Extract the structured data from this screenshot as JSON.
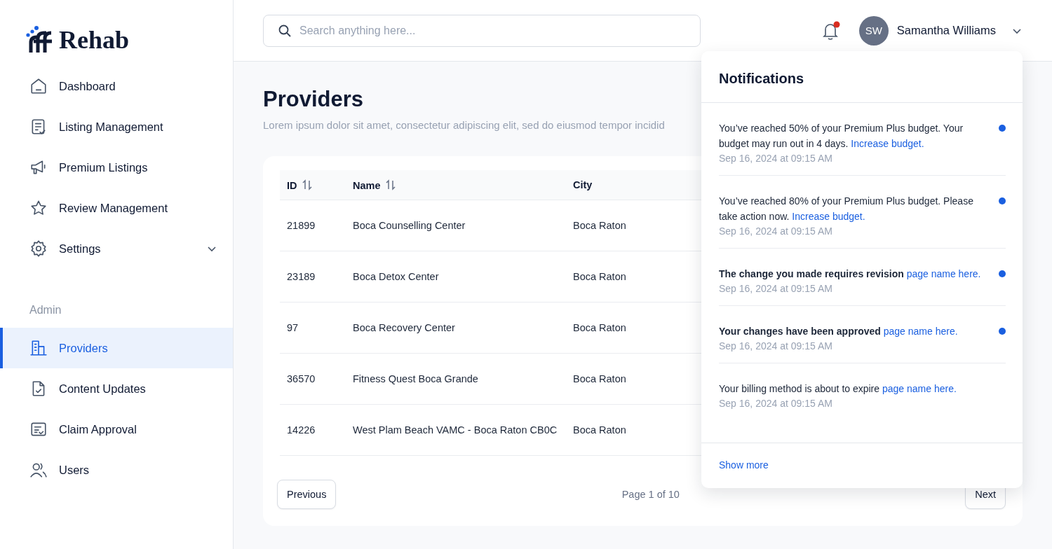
{
  "logo": {
    "text": "Rehab"
  },
  "sidebar": {
    "items": [
      {
        "label": "Dashboard",
        "selected": false
      },
      {
        "label": "Listing Management",
        "selected": false
      },
      {
        "label": "Premium Listings",
        "selected": false
      },
      {
        "label": "Review Management",
        "selected": false
      },
      {
        "label": "Settings",
        "selected": false,
        "expanded": false
      }
    ],
    "section_label": "Admin",
    "admin_items": [
      {
        "label": "Providers",
        "selected": true
      },
      {
        "label": "Content Updates",
        "selected": false
      },
      {
        "label": "Claim Approval",
        "selected": false
      },
      {
        "label": "Users",
        "selected": false
      }
    ]
  },
  "search": {
    "placeholder": "Search anything here..."
  },
  "user": {
    "initials": "SW",
    "name": "Samantha Williams",
    "has_unread": true
  },
  "page": {
    "title": "Providers",
    "subtitle": "Lorem ipsum dolor sit amet, consectetur adipiscing elit, sed do eiusmod tempor incidid"
  },
  "table": {
    "columns": [
      {
        "label": "ID",
        "sortable": true
      },
      {
        "label": "Name",
        "sortable": true
      },
      {
        "label": "City",
        "sortable": false
      }
    ],
    "rows": [
      [
        "21899",
        "Boca Counselling Center",
        "Boca Raton"
      ],
      [
        "23189",
        "Boca Detox Center",
        "Boca Raton"
      ],
      [
        "97",
        "Boca Recovery Center",
        "Boca Raton"
      ],
      [
        "36570",
        "Fitness Quest Boca Grande",
        "Boca Raton"
      ],
      [
        "14226",
        "West Plam Beach VAMC - Boca Raton CB0C",
        "Boca Raton"
      ]
    ]
  },
  "pagination": {
    "previous": "Previous",
    "page": "Page 1 of 10",
    "next": "Next"
  },
  "notifications": {
    "title": "Notifications",
    "items": [
      {
        "text": "You’ve reached 50% of your Premium Plus budget. Your budget may run out in 4 days.",
        "link": "Increase budget.",
        "time": "Sep 16, 2024 at 09:15 AM",
        "unread": true,
        "bold": false
      },
      {
        "text": "You’ve reached 80% of your Premium Plus budget. Please take action now.",
        "link": "Increase budget.",
        "time": "Sep 16, 2024 at 09:15 AM",
        "unread": true,
        "bold": false
      },
      {
        "text": "The change you made requires revision",
        "link": "page name here.",
        "time": "Sep 16, 2024 at 09:15 AM",
        "unread": true,
        "bold": true
      },
      {
        "text": "Your changes have been approved",
        "link": "page name here.",
        "time": "Sep 16, 2024 at 09:15 AM",
        "unread": true,
        "bold": true
      },
      {
        "text": "Your billing method is about to expire",
        "link": "page name here.",
        "time": "Sep 16, 2024 at 09:15 AM",
        "unread": false,
        "bold": false
      }
    ],
    "show_more": "Show more"
  }
}
